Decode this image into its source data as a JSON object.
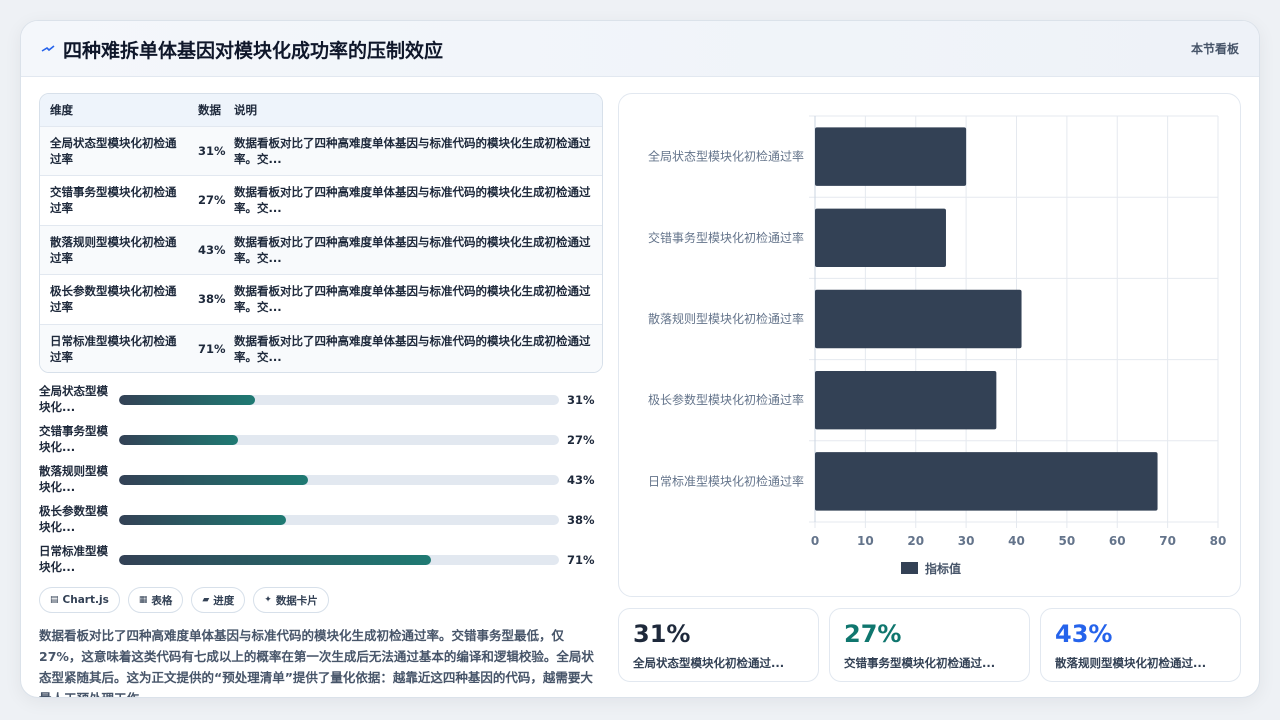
{
  "header": {
    "title": "四种难拆单体基因对模块化成功率的压制效应",
    "right_label": "本节看板"
  },
  "table": {
    "headers": [
      "维度",
      "数据",
      "说明"
    ],
    "rows": [
      {
        "dimension": "全局状态型模块化初检通过率",
        "value": "31%",
        "note": "数据看板对比了四种高难度单体基因与标准代码的模块化生成初检通过率。交..."
      },
      {
        "dimension": "交错事务型模块化初检通过率",
        "value": "27%",
        "note": "数据看板对比了四种高难度单体基因与标准代码的模块化生成初检通过率。交..."
      },
      {
        "dimension": "散落规则型模块化初检通过率",
        "value": "43%",
        "note": "数据看板对比了四种高难度单体基因与标准代码的模块化生成初检通过率。交..."
      },
      {
        "dimension": "极长参数型模块化初检通过率",
        "value": "38%",
        "note": "数据看板对比了四种高难度单体基因与标准代码的模块化生成初检通过率。交..."
      },
      {
        "dimension": "日常标准型模块化初检通过率",
        "value": "71%",
        "note": "数据看板对比了四种高难度单体基因与标准代码的模块化生成初检通过率。交..."
      }
    ]
  },
  "progress": [
    {
      "label": "全局状态型模块化...",
      "value_text": "31%",
      "fraction": 0.31
    },
    {
      "label": "交错事务型模块化...",
      "value_text": "27%",
      "fraction": 0.27
    },
    {
      "label": "散落规则型模块化...",
      "value_text": "43%",
      "fraction": 0.43
    },
    {
      "label": "极长参数型模块化...",
      "value_text": "38%",
      "fraction": 0.38
    },
    {
      "label": "日常标准型模块化...",
      "value_text": "71%",
      "fraction": 0.71
    }
  ],
  "chips": [
    {
      "icon": "chart-icon",
      "glyph": "▤",
      "label": "Chart.js"
    },
    {
      "icon": "table-icon",
      "glyph": "▦",
      "label": "表格"
    },
    {
      "icon": "progress-icon",
      "glyph": "▰",
      "label": "进度"
    },
    {
      "icon": "card-icon",
      "glyph": "✦",
      "label": "数据卡片"
    }
  ],
  "summary": "数据看板对比了四种高难度单体基因与标准代码的模块化生成初检通过率。交错事务型最低，仅27%，这意味着这类代码有七成以上的概率在第一次生成后无法通过基本的编译和逻辑校验。全局状态型紧随其后。这为正文提供的“预处理清单”提供了量化依据：越靠近这四种基因的代码，越需要大量人工预处理工作。",
  "chart_data": {
    "type": "bar",
    "orientation": "horizontal",
    "categories": [
      "全局状态型模块化初检通过率",
      "交错事务型模块化初检通过率",
      "散落规则型模块化初检通过率",
      "极长参数型模块化初检通过率",
      "日常标准型模块化初检通过率"
    ],
    "series": [
      {
        "name": "指标值",
        "values": [
          30,
          26,
          41,
          36,
          68
        ],
        "color": "#334155"
      }
    ],
    "xlim": [
      0,
      80
    ],
    "xticks": [
      0,
      10,
      20,
      30,
      40,
      50,
      60,
      70,
      80
    ],
    "grid": true,
    "legend": "bottom"
  },
  "kpis": [
    {
      "value": "31%",
      "label": "全局状态型模块化初检通过...",
      "color": "#1e293b"
    },
    {
      "value": "27%",
      "label": "交错事务型模块化初检通过...",
      "color": "#0f766e"
    },
    {
      "value": "43%",
      "label": "散落规则型模块化初检通过...",
      "color": "#2563eb"
    }
  ]
}
